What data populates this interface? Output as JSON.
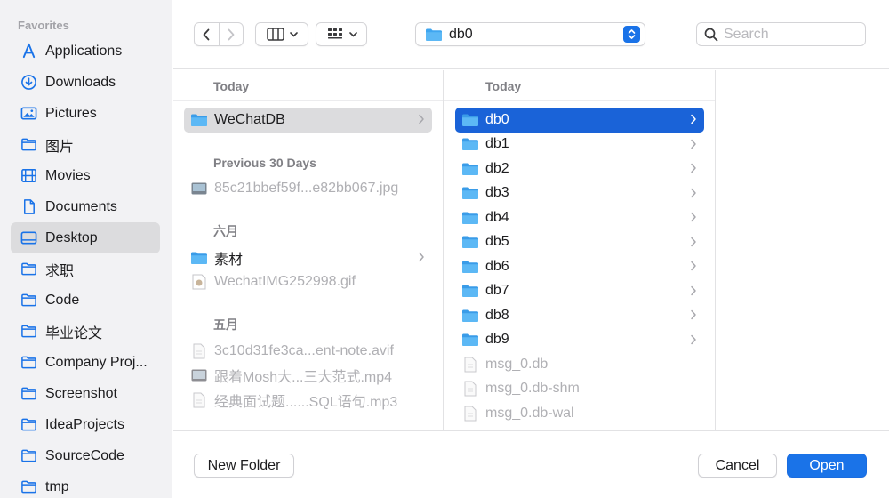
{
  "colors": {
    "accent": "#1a73e8",
    "selection_blue": "#1a63d8",
    "folder_blue": "#3fa6f0"
  },
  "sidebar": {
    "heading": "Favorites",
    "items": [
      {
        "label": "Applications",
        "icon": "applications-icon"
      },
      {
        "label": "Downloads",
        "icon": "download-circle-icon"
      },
      {
        "label": "Pictures",
        "icon": "photo-icon"
      },
      {
        "label": "图片",
        "icon": "folder-icon"
      },
      {
        "label": "Movies",
        "icon": "film-icon"
      },
      {
        "label": "Documents",
        "icon": "document-icon"
      },
      {
        "label": "Desktop",
        "icon": "desktop-icon",
        "selected": true
      },
      {
        "label": "求职",
        "icon": "folder-icon"
      },
      {
        "label": "Code",
        "icon": "folder-icon"
      },
      {
        "label": "毕业论文",
        "icon": "folder-icon"
      },
      {
        "label": "Company Proj...",
        "icon": "folder-icon"
      },
      {
        "label": "Screenshot",
        "icon": "folder-icon"
      },
      {
        "label": "IdeaProjects",
        "icon": "folder-icon"
      },
      {
        "label": "SourceCode",
        "icon": "folder-icon"
      },
      {
        "label": "tmp",
        "icon": "folder-icon"
      }
    ]
  },
  "toolbar": {
    "path_label": "db0",
    "search_placeholder": "Search"
  },
  "column1": {
    "sections": [
      {
        "heading": "Today",
        "items": [
          {
            "name": "WeChatDB",
            "kind": "folder",
            "selected": true
          }
        ]
      },
      {
        "heading": "Previous 30 Days",
        "items": [
          {
            "name": "85c21bbef59f...e82bb067.jpg",
            "kind": "image",
            "dim": true
          }
        ]
      },
      {
        "heading": "六月",
        "items": [
          {
            "name": "素材",
            "kind": "folder"
          },
          {
            "name": "WechatIMG252998.gif",
            "kind": "gif",
            "dim": true
          }
        ]
      },
      {
        "heading": "五月",
        "items": [
          {
            "name": "3c10d31fe3ca...ent-note.avif",
            "kind": "file",
            "dim": true
          },
          {
            "name": "跟着Mosh大...三大范式.mp4",
            "kind": "video",
            "dim": true
          },
          {
            "name": "经典面试题......SQL语句.mp3",
            "kind": "file",
            "dim": true
          }
        ]
      }
    ]
  },
  "column2": {
    "heading": "Today",
    "items": [
      {
        "name": "db0",
        "kind": "folder",
        "selected": true
      },
      {
        "name": "db1",
        "kind": "folder"
      },
      {
        "name": "db2",
        "kind": "folder"
      },
      {
        "name": "db3",
        "kind": "folder"
      },
      {
        "name": "db4",
        "kind": "folder"
      },
      {
        "name": "db5",
        "kind": "folder"
      },
      {
        "name": "db6",
        "kind": "folder"
      },
      {
        "name": "db7",
        "kind": "folder"
      },
      {
        "name": "db8",
        "kind": "folder"
      },
      {
        "name": "db9",
        "kind": "folder"
      },
      {
        "name": "msg_0.db",
        "kind": "file",
        "dim": true
      },
      {
        "name": "msg_0.db-shm",
        "kind": "file",
        "dim": true
      },
      {
        "name": "msg_0.db-wal",
        "kind": "file",
        "dim": true
      }
    ]
  },
  "footer": {
    "new_folder_label": "New Folder",
    "cancel_label": "Cancel",
    "open_label": "Open"
  }
}
